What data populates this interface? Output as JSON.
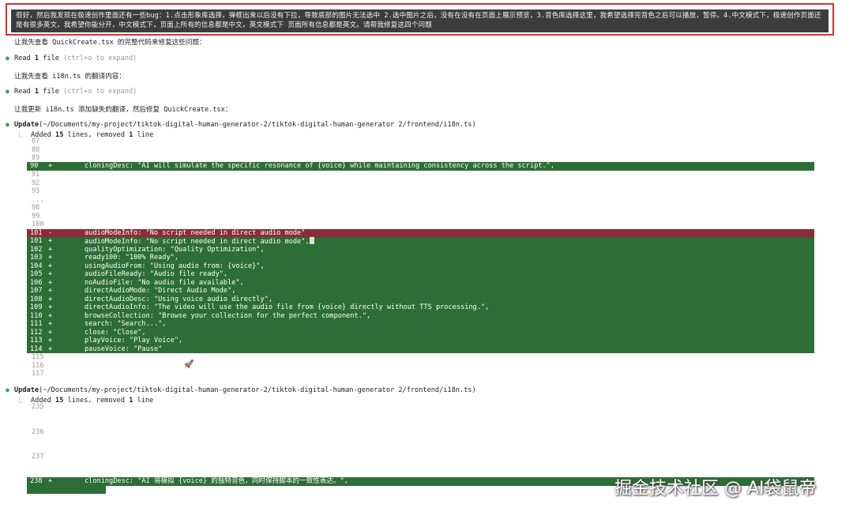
{
  "prompt": {
    "text": "很好，然后我发现在极速创作里面还有一些bug：1.点击形象库选择，弹框出来以后没有下拉，导致底部的图片无法选中 2.选中图片之后，没有在没有在页面上展示预览，3.音色库选择这里，我希望选择完音色之后可以播放，暂停。4.中文模式下，极速创作页面还是有很多英文，我希望你能分开，中文模式下，页面上所有的信息都是中文，英文模式下 页面所有信息都是英文。请帮我修复这四个问题"
  },
  "messages": {
    "m1": "让我先查看 QuickCreate.tsx 的完整代码来修复这些问题：",
    "read1_label": "Read",
    "read1_count": "1",
    "read1_word": "file",
    "read1_hint": "(ctrl+o to expand)",
    "m2": "让我先查看 i18n.ts 的翻译内容：",
    "read2_label": "Read",
    "read2_count": "1",
    "read2_word": "file",
    "read2_hint": "(ctrl+o to expand)",
    "m3": "让我更新 i18n.ts 添加缺失的翻译，然后修复 QuickCreate.tsx："
  },
  "update1": {
    "label": "Update",
    "path": "(~/Documents/my-project/tiktok-digital-human-generator-2/tiktok-digital-human-generator 2/frontend/i18n.ts)",
    "summary_pre": "Added",
    "summary_added": "15",
    "summary_mid": "lines, removed",
    "summary_removed": "1",
    "summary_post": "line",
    "context_a": [
      "87",
      "88",
      "89"
    ],
    "row90": {
      "num": "90",
      "sign": "+",
      "code": "cloningDesc: \"AI will simulate the specific resonance of {voice} while maintaining consistency across the script.\","
    },
    "context_b": [
      "91",
      "92",
      "93"
    ],
    "ellipsis": "...",
    "context_c": [
      "98",
      "99",
      "100"
    ],
    "removed_row": {
      "num": "101",
      "sign": "-",
      "code": "audioModeInfo: \"No script needed in direct audio mode\""
    },
    "added_rows": [
      {
        "num": "101",
        "sign": "+",
        "code": "audioModeInfo: \"No script needed in direct audio mode\","
      },
      {
        "num": "102",
        "sign": "+",
        "code": "qualityOptimization: \"Quality Optimization\","
      },
      {
        "num": "103",
        "sign": "+",
        "code": "ready100: \"100% Ready\","
      },
      {
        "num": "104",
        "sign": "+",
        "code": "usingAudioFrom: \"Using audio from: {voice}\","
      },
      {
        "num": "105",
        "sign": "+",
        "code": "audioFileReady: \"Audio file ready\","
      },
      {
        "num": "106",
        "sign": "+",
        "code": "noAudioFile: \"No audio file available\","
      },
      {
        "num": "107",
        "sign": "+",
        "code": "directAudioMode: \"Direct Audio Mode\","
      },
      {
        "num": "108",
        "sign": "+",
        "code": "directAudioDesc: \"Using voice audio directly\","
      },
      {
        "num": "109",
        "sign": "+",
        "code": "directAudioInfo: \"The video will use the audio file from {voice} directly without TTS processing.\","
      },
      {
        "num": "110",
        "sign": "+",
        "code": "browseCollection: \"Browse your collection for the perfect component.\","
      },
      {
        "num": "111",
        "sign": "+",
        "code": "search: \"Search...\","
      },
      {
        "num": "112",
        "sign": "+",
        "code": "close: \"Close\","
      },
      {
        "num": "113",
        "sign": "+",
        "code": "playVoice: \"Play Voice\","
      },
      {
        "num": "114",
        "sign": "+",
        "code": "pauseVoice: \"Pause\""
      }
    ],
    "context_d": [
      "115",
      "116",
      "117"
    ]
  },
  "update2": {
    "label": "Update",
    "path": "(~/Documents/my-project/tiktok-digital-human-generator-2/tiktok-digital-human-generator 2/frontend/i18n.ts)",
    "summary_pre": "Added",
    "summary_added": "15",
    "summary_mid": "lines, removed",
    "summary_removed": "1",
    "summary_post": "line",
    "context": [
      "235",
      "236",
      "237"
    ],
    "row238": {
      "num": "238",
      "sign": "+",
      "code": "cloningDesc: \"AI 将模拟 {voice} 的独特音色，同时保持脚本的一致性表达。\","
    }
  },
  "icons": {
    "bullet": "bullet-dot-icon",
    "rocket": "rocket-icon"
  },
  "watermark": "掘金技术社区 @ AI袋鼠帝",
  "colors": {
    "added": "#2c6e35",
    "removed": "#8c2b3a",
    "highlight_border": "#d9302f",
    "bullet": "#2fa84f"
  }
}
